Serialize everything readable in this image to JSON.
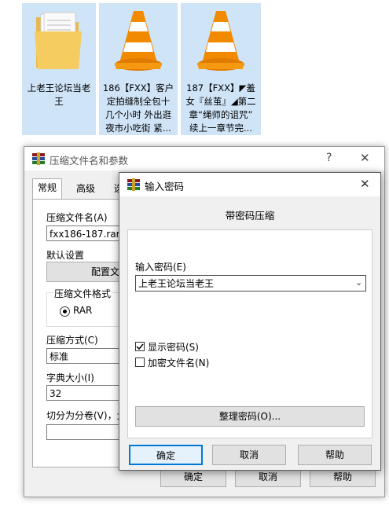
{
  "files": [
    {
      "label": "上老王论坛当老\n王",
      "icon": "folder-icon"
    },
    {
      "label": "186【FXX】客户\n定拍缝制全包十\n几个小时 外出逛\n夜市小吃街 紧...",
      "icon": "vlc-cone-icon"
    },
    {
      "label": "187【FXX】◤羞\n女『丝茧』◢第二\n章“绳师的诅咒”\n续上一章节完...",
      "icon": "vlc-cone-icon"
    }
  ],
  "archive_dialog": {
    "title": "压缩文件名和参数",
    "help_glyph": "?",
    "close_glyph": "✕",
    "tabs": [
      "常规",
      "高级",
      "选"
    ],
    "archive_name_label": "压缩文件名(A)",
    "archive_name_value": "fxx186-187.rar",
    "default_settings_label": "默认设置",
    "profiles_button": "配置文件",
    "format_label": "压缩文件格式",
    "format_rar": "RAR",
    "method_label": "压缩方式(C)",
    "method_value": "标准",
    "dict_label": "字典大小(I)",
    "dict_value": "32",
    "split_label": "切分为分卷(V)，大",
    "ok": "确定",
    "cancel": "取消",
    "help": "帮助"
  },
  "password_dialog": {
    "title": "输入密码",
    "close_glyph": "✕",
    "heading": "带密码压缩",
    "enter_label": "输入密码(E)",
    "password_value": "上老王论坛当老王",
    "show_password_label": "显示密码(S)",
    "show_password_checked": true,
    "encrypt_names_label": "加密文件名(N)",
    "encrypt_names_checked": false,
    "organize_button": "整理密码(O)...",
    "ok": "确定",
    "cancel": "取消",
    "help": "帮助"
  }
}
